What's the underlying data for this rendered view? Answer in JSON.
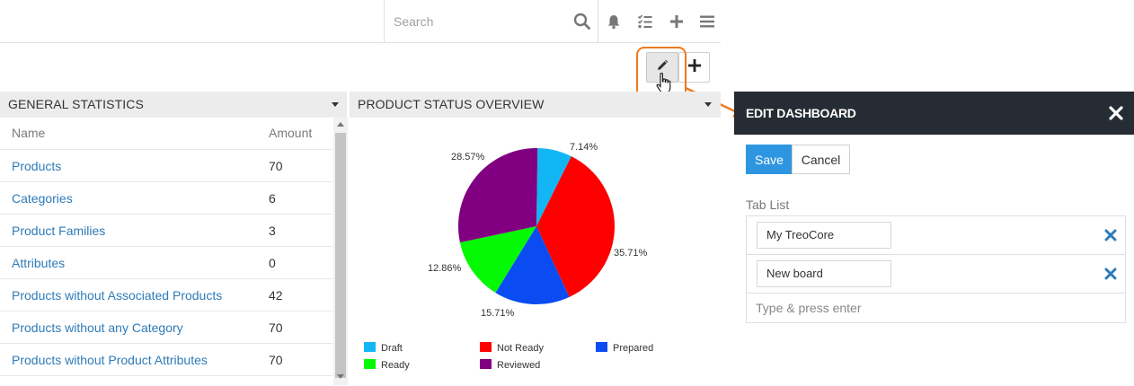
{
  "topbar": {
    "search_placeholder": "Search",
    "icons": [
      "search-icon",
      "bell-icon",
      "task-list-icon",
      "plus-icon",
      "menu-icon"
    ]
  },
  "dashboard_actions": {
    "edit_icon": "pencil-icon",
    "add_icon": "plus-icon"
  },
  "general_statistics": {
    "title": "GENERAL STATISTICS",
    "columns": [
      "Name",
      "Amount"
    ],
    "rows": [
      {
        "name": "Products",
        "amount": "70"
      },
      {
        "name": "Categories",
        "amount": "6"
      },
      {
        "name": "Product Families",
        "amount": "3"
      },
      {
        "name": "Attributes",
        "amount": "0"
      },
      {
        "name": "Products without Associated Products",
        "amount": "42"
      },
      {
        "name": "Products without any Category",
        "amount": "70"
      },
      {
        "name": "Products without Product Attributes",
        "amount": "70"
      }
    ]
  },
  "product_status": {
    "title": "PRODUCT STATUS OVERVIEW"
  },
  "chart_data": {
    "type": "pie",
    "title": "",
    "slices": [
      {
        "label": "Draft",
        "value": 7.14,
        "color": "#13b6f5"
      },
      {
        "label": "Not Ready",
        "value": 35.71,
        "color": "#fe0000"
      },
      {
        "label": "Prepared",
        "value": 15.71,
        "color": "#0b4cf2"
      },
      {
        "label": "Ready",
        "value": 12.86,
        "color": "#05f905"
      },
      {
        "label": "Reviewed",
        "value": 28.57,
        "color": "#800081"
      }
    ],
    "value_labels": [
      "7.14%",
      "35.71%",
      "15.71%",
      "12.86%",
      "28.57%"
    ],
    "legend_position": "bottom"
  },
  "edit_dashboard": {
    "title": "EDIT DASHBOARD",
    "save_label": "Save",
    "cancel_label": "Cancel",
    "tab_list_label": "Tab List",
    "tabs": [
      "My TreoCore",
      "New board"
    ],
    "new_tab_placeholder": "Type & press enter",
    "accent_color": "#2e96e0",
    "highlight_color": "#f07a1e"
  }
}
